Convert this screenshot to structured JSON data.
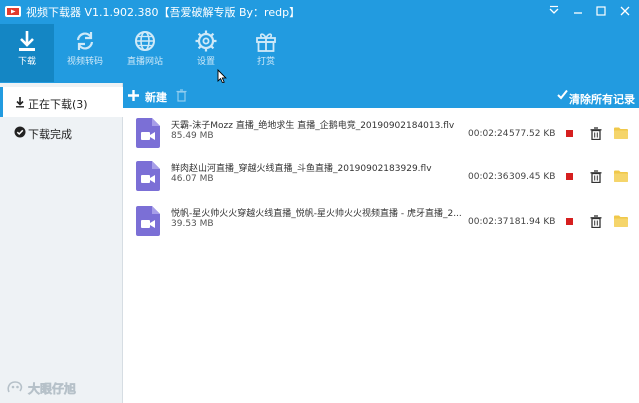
{
  "window": {
    "title": "视频下载器 V1.1.902.380【吾爱破解专版  By：redp】"
  },
  "toolbar_top": [
    {
      "label": "下载",
      "icon": "download-icon",
      "active": true
    },
    {
      "label": "视频转码",
      "icon": "sync-icon"
    },
    {
      "label": "直播网站",
      "icon": "globe-icon"
    },
    {
      "label": "设置",
      "icon": "gear-icon"
    },
    {
      "label": "打赏",
      "icon": "gift-icon"
    }
  ],
  "sidebar": {
    "items": [
      {
        "label": "正在下载(3)",
        "icon": "download-arrow-icon",
        "active": true
      },
      {
        "label": "下载完成",
        "icon": "check-circle-icon"
      }
    ]
  },
  "watermark": {
    "text": "大眼仔旭"
  },
  "list_toolbar": {
    "new_label": "新建",
    "clear_label": "清除所有记录"
  },
  "downloads": [
    {
      "name": "天霸-沫子Mozz 直播_绝地求生 直播_企鹅电竞_20190902184013.flv",
      "size": "85.49 MB",
      "duration": "00:02:24",
      "speed": "577.52 KB"
    },
    {
      "name": "鲜肉赵山河直播_穿越火线直播_斗鱼直播_20190902183929.flv",
      "size": "46.07 MB",
      "duration": "00:02:36",
      "speed": "309.45 KB"
    },
    {
      "name": "悦帆-星火帅火火穿越火线直播_悦帆-星火帅火火视频直播 - 虎牙直播_2...",
      "size": "39.53 MB",
      "duration": "00:02:37",
      "speed": "181.94 KB"
    }
  ],
  "colors": {
    "accent": "#229be0",
    "active_tab": "#1486c4",
    "file_icon": "#7b6fd6",
    "stop": "#d61f1f",
    "folder": "#f0c84a"
  }
}
